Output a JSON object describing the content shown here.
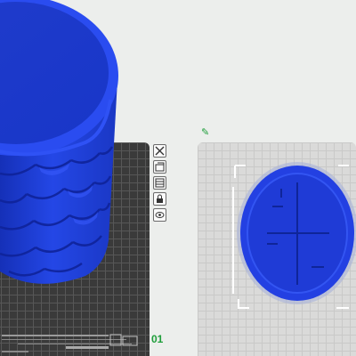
{
  "viewport": {
    "plates": [
      {
        "label": "01",
        "label_color": "#1e9e3a",
        "bed_color": "#3a3a3a",
        "grid_color": "#575757"
      },
      {
        "label": "",
        "bed_color": "#dadad9",
        "grid_color": "#c9c9c8"
      }
    ],
    "plate_toolbar": [
      {
        "icon": "close-icon"
      },
      {
        "icon": "arrange-icon"
      },
      {
        "icon": "orient-icon"
      },
      {
        "icon": "lock-icon"
      },
      {
        "icon": "eye-icon"
      }
    ],
    "edit_icon": "pencil-icon",
    "models": [
      {
        "name": "dragon-scale-cup",
        "color": "#1f3fd8"
      },
      {
        "name": "coaster-lid",
        "color": "#1f3fd8"
      }
    ]
  }
}
